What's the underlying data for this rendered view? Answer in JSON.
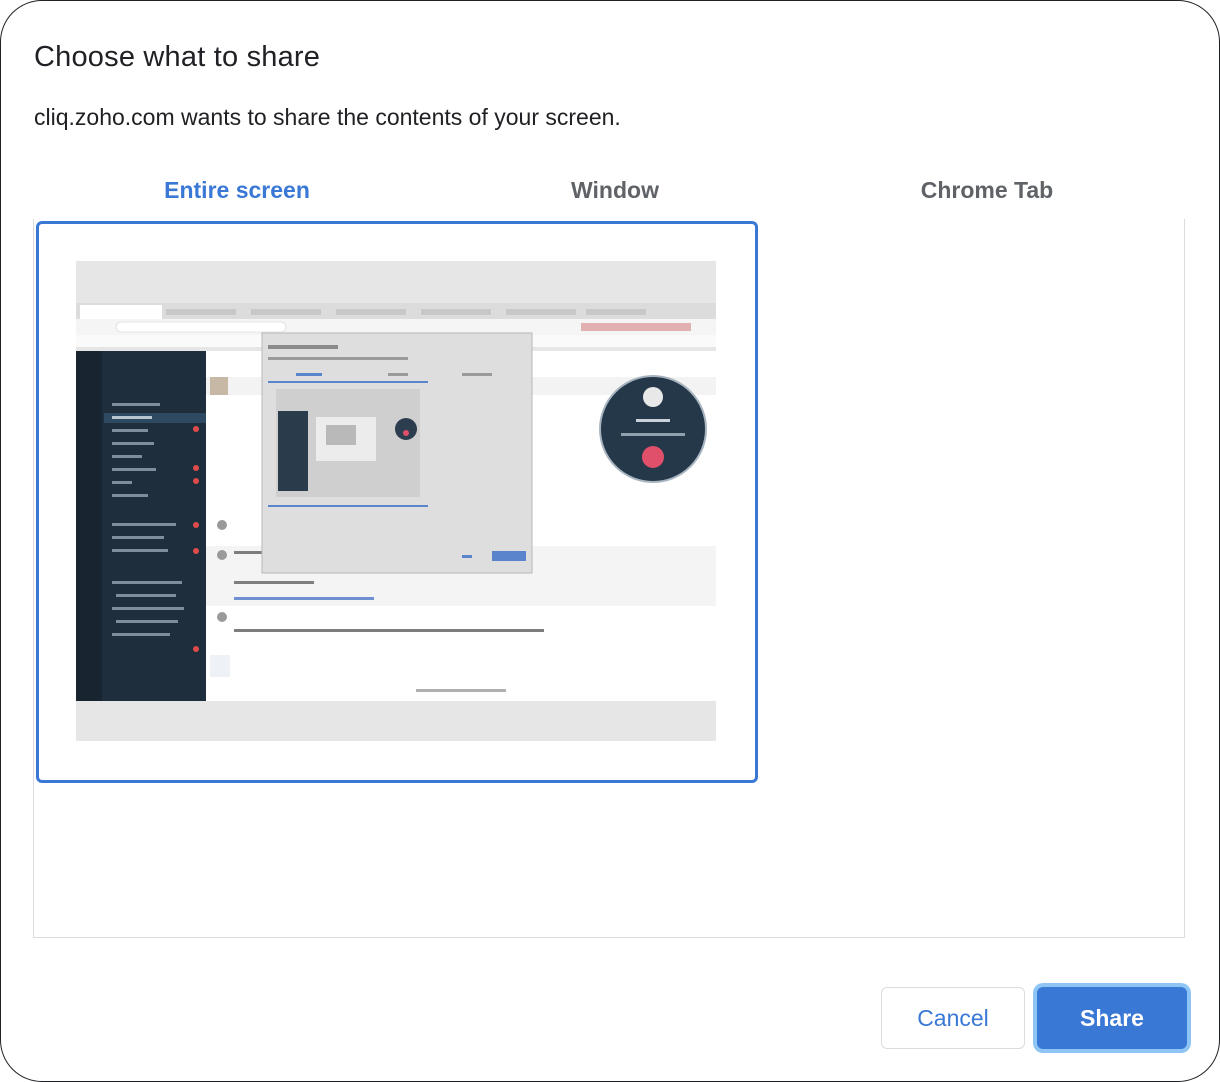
{
  "dialog": {
    "title": "Choose what to share",
    "subtitle": "cliq.zoho.com wants to share the contents of your screen."
  },
  "tabs": [
    {
      "label": "Entire screen",
      "active": true
    },
    {
      "label": "Window",
      "active": false
    },
    {
      "label": "Chrome Tab",
      "active": false
    }
  ],
  "sources": [
    {
      "kind": "entire-screen",
      "selected": true
    }
  ],
  "buttons": {
    "cancel_label": "Cancel",
    "share_label": "Share"
  },
  "colors": {
    "accent": "#3a78d6",
    "focus_ring": "#8ec5f5",
    "divider": "#dadce0",
    "text": "#202124",
    "muted_text": "#5f6368"
  }
}
